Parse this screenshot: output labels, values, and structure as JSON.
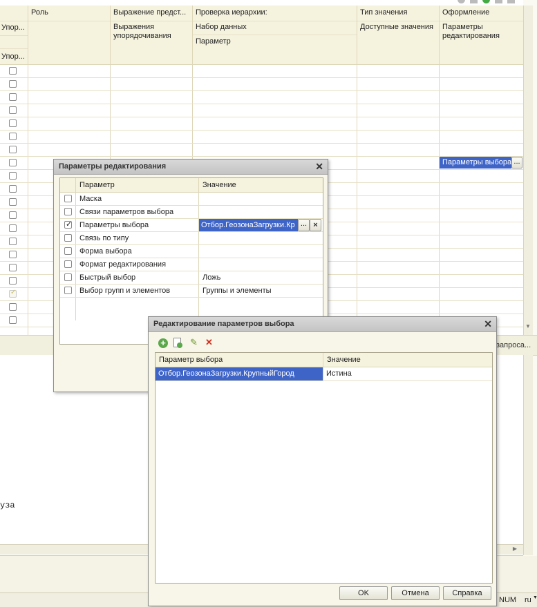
{
  "bg_table": {
    "columns": [
      {
        "top": "Роль",
        "mid": "",
        "bot": ""
      },
      {
        "top": "Выражение предст...",
        "mid": "Выражения упорядочивания",
        "bot": ""
      },
      {
        "top": "Проверка иерархии:",
        "mid": "Набор данных",
        "bot": "Параметр"
      },
      {
        "top": "Тип значения",
        "mid": "Доступные значения",
        "bot": ""
      },
      {
        "top": "Оформление",
        "mid": "Параметры редактирования",
        "bot": ""
      }
    ],
    "left_col": {
      "header1": "Упор...",
      "header2": "Упор..."
    },
    "row_value": "Параметры выбора",
    "ellipsis": "...",
    "query_link": "запроса..."
  },
  "side_text": "уза",
  "status_bar": {
    "num": "NUM",
    "lang": "ru"
  },
  "edit_params_dialog": {
    "title": "Параметры редактирования",
    "col_param": "Параметр",
    "col_value": "Значение",
    "rows": [
      {
        "name": "Маска",
        "value": "",
        "checked": false
      },
      {
        "name": "Связи параметров выбора",
        "value": "",
        "checked": false
      },
      {
        "name": "Параметры выбора",
        "value": "Отбор.ГеозонаЗагрузки.Кр",
        "checked": true
      },
      {
        "name": "Связь по типу",
        "value": "",
        "checked": false
      },
      {
        "name": "Форма выбора",
        "value": "",
        "checked": false
      },
      {
        "name": "Формат редактирования",
        "value": "",
        "checked": false
      },
      {
        "name": "Быстрый выбор",
        "value": "Ложь",
        "checked": false
      },
      {
        "name": "Выбор групп и элементов",
        "value": "Группы и элементы",
        "checked": false
      }
    ],
    "ellipsis": "...",
    "clear": "×"
  },
  "choice_params_dialog": {
    "title": "Редактирование параметров выбора",
    "col_param": "Параметр выбора",
    "col_value": "Значение",
    "rows": [
      {
        "param": "Отбор.ГеозонаЗагрузки.КрупныйГород",
        "value": "Истина"
      }
    ],
    "ok": "OK",
    "cancel": "Отмена",
    "help": "Справка",
    "toolbar": [
      "add-icon",
      "copy-icon",
      "edit-icon",
      "delete-icon"
    ]
  }
}
